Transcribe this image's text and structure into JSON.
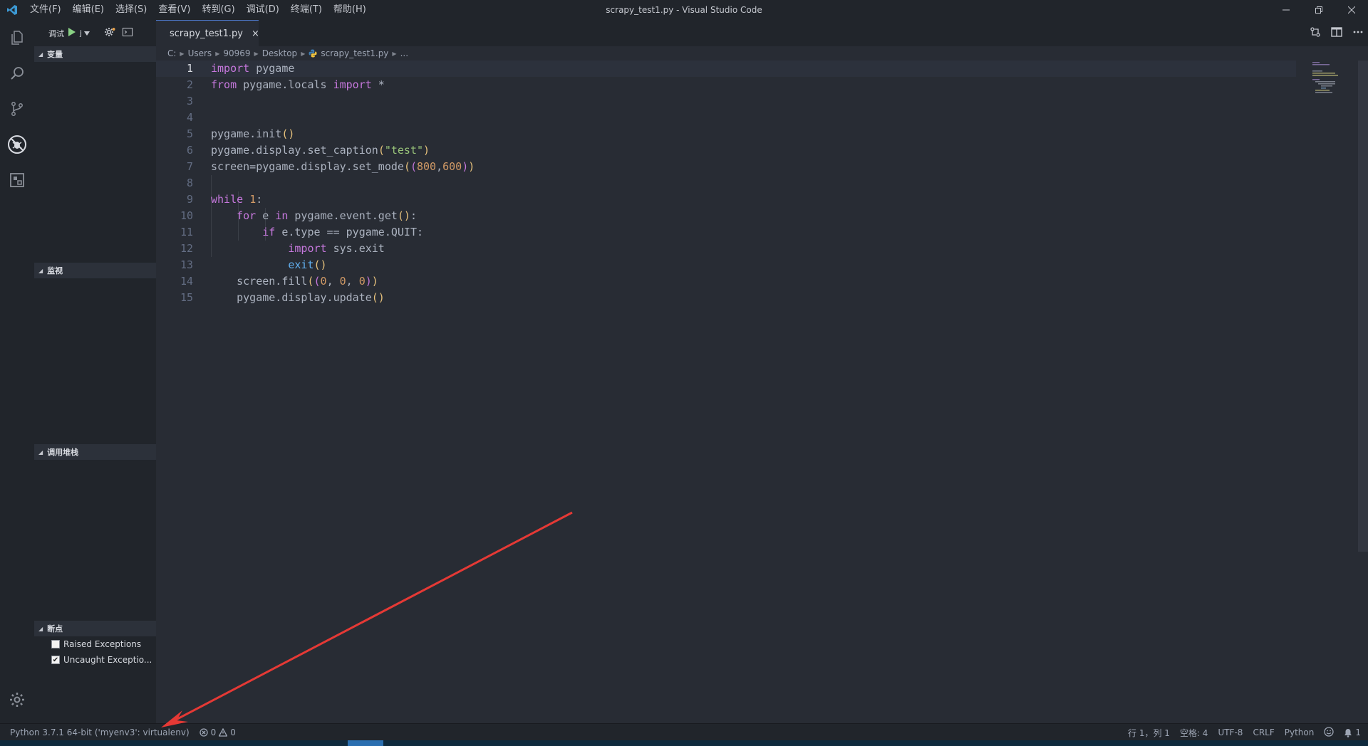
{
  "window": {
    "title": "scrapy_test1.py - Visual Studio Code"
  },
  "menu": [
    "文件(F)",
    "编辑(E)",
    "选择(S)",
    "查看(V)",
    "转到(G)",
    "调试(D)",
    "终端(T)",
    "帮助(H)"
  ],
  "debug_toolbar": {
    "label": "调试",
    "config_label": "j"
  },
  "sidebar": {
    "sections": {
      "variables": "变量",
      "watch": "监视",
      "callstack": "调用堆栈",
      "breakpoints": "断点"
    },
    "breakpoints": [
      {
        "label": "Raised Exceptions",
        "checked": false
      },
      {
        "label": "Uncaught Exceptio...",
        "checked": true
      }
    ]
  },
  "tab": {
    "label": "scrapy_test1.py",
    "close": "×"
  },
  "breadcrumb": [
    "C:",
    "Users",
    "90969",
    "Desktop",
    "scrapy_test1.py",
    "..."
  ],
  "editor": {
    "line_numbers": [
      "1",
      "2",
      "3",
      "4",
      "5",
      "6",
      "7",
      "8",
      "9",
      "10",
      "11",
      "12",
      "13",
      "14",
      "15"
    ],
    "active_line": 1
  },
  "statusbar": {
    "interpreter": "Python 3.7.1 64-bit ('myenv3': virtualenv)",
    "errors": "0",
    "warnings": "0",
    "position": "行 1，列 1",
    "spaces": "空格: 4",
    "encoding": "UTF-8",
    "eol": "CRLF",
    "language": "Python",
    "notifications": "1"
  },
  "colors": {
    "accent": "#4d78cc",
    "annotation_arrow": "#e53935"
  }
}
